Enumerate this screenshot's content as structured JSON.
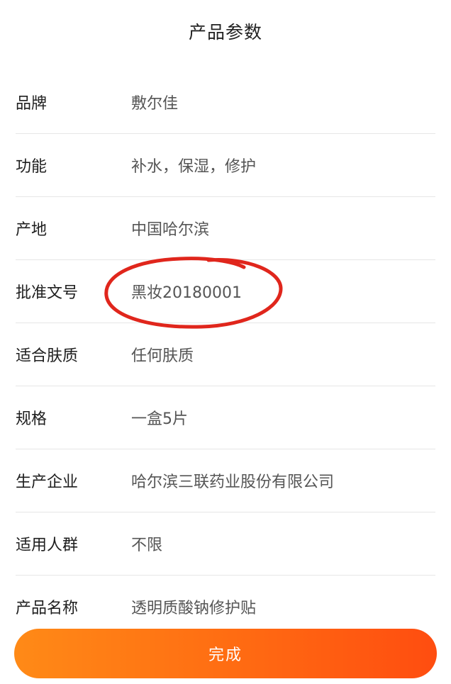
{
  "header": {
    "title": "产品参数"
  },
  "params": [
    {
      "label": "品牌",
      "value": "敷尔佳"
    },
    {
      "label": "功能",
      "value": "补水，保湿，修护"
    },
    {
      "label": "产地",
      "value": "中国哈尔滨"
    },
    {
      "label": "批准文号",
      "value": "黑妆20180001"
    },
    {
      "label": "适合肤质",
      "value": "任何肤质"
    },
    {
      "label": "规格",
      "value": "一盒5片"
    },
    {
      "label": "生产企业",
      "value": "哈尔滨三联药业股份有限公司"
    },
    {
      "label": "适用人群",
      "value": "不限"
    },
    {
      "label": "产品名称",
      "value": "透明质酸钠修护贴"
    }
  ],
  "footer": {
    "done_label": "完成"
  },
  "colors": {
    "button_gradient_start": "#ff8a17",
    "button_gradient_end": "#ff4d10",
    "annotation": "#e0261c"
  }
}
